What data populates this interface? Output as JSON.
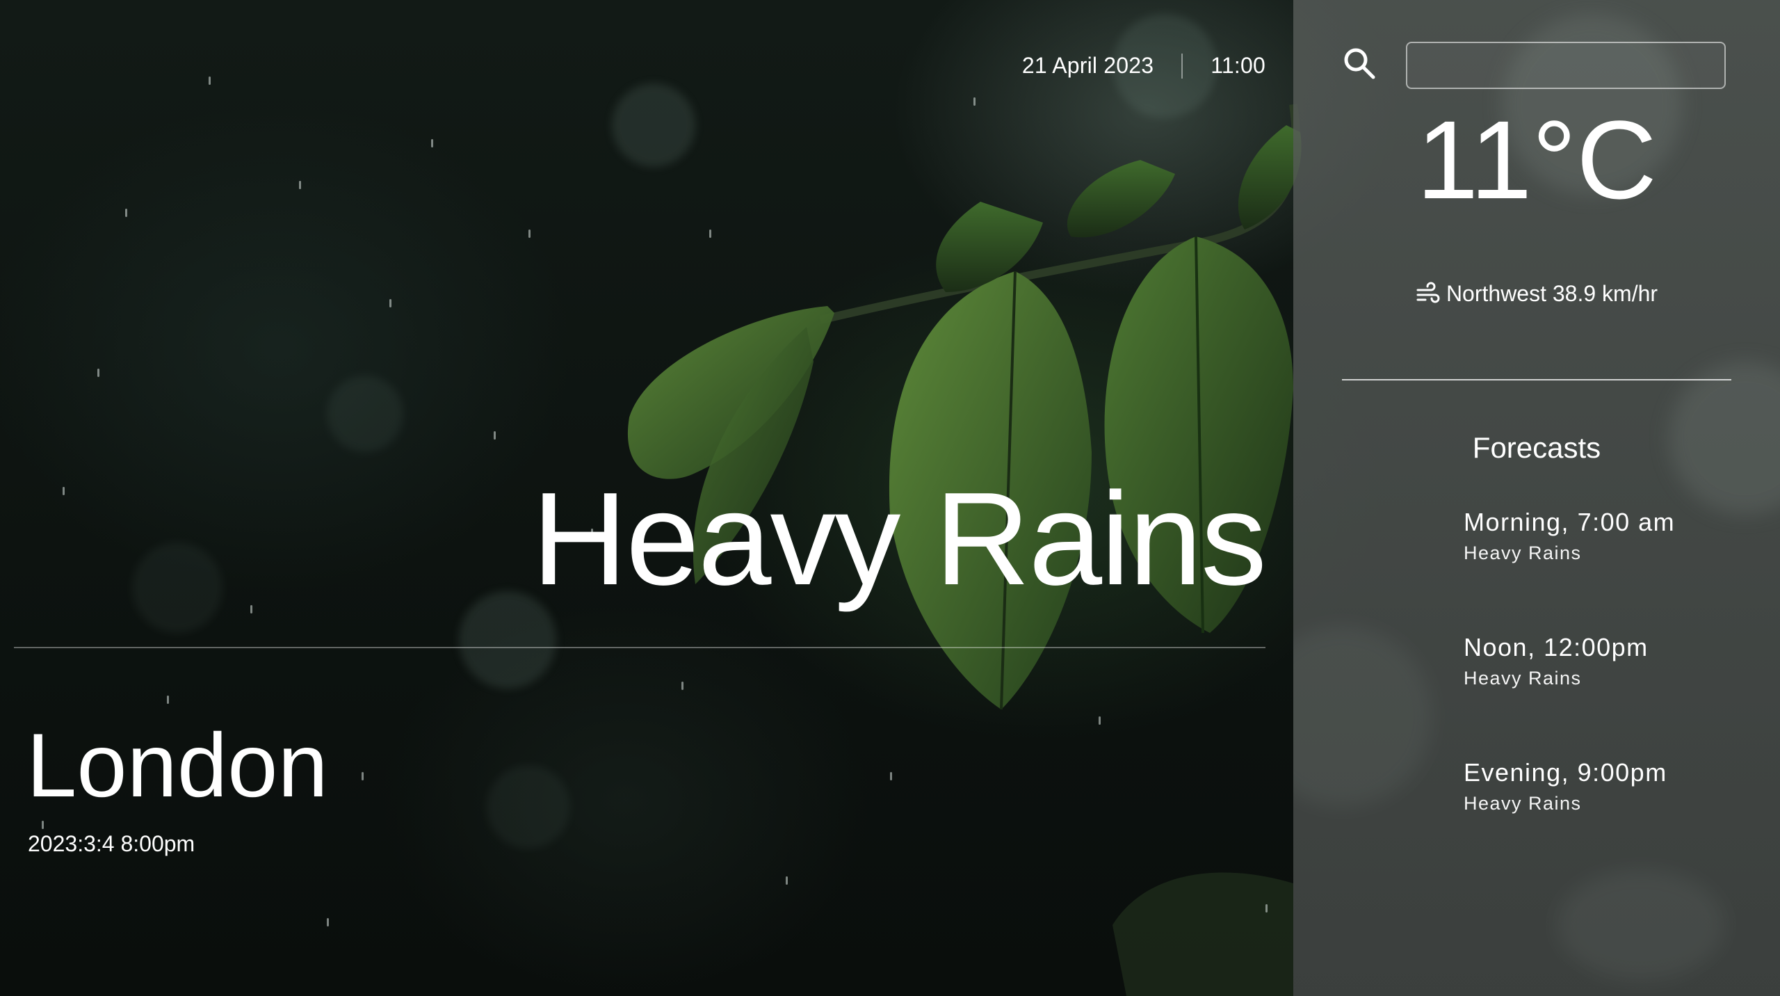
{
  "header": {
    "date": "21 April 2023",
    "time": "11:00"
  },
  "main": {
    "condition": "Heavy Rains",
    "city": "London",
    "city_datetime": "2023:3:4 8:00pm"
  },
  "panel": {
    "search": {
      "value": "",
      "placeholder": "",
      "icon": "search-icon"
    },
    "temperature": "11°C",
    "wind": {
      "icon": "wind-icon",
      "text": "Northwest 38.9 km/hr"
    },
    "forecasts_title": "Forecasts",
    "forecasts": [
      {
        "when": "Morning, 7:00 am",
        "condition": "Heavy Rains"
      },
      {
        "when": "Noon, 12:00pm",
        "condition": "Heavy Rains"
      },
      {
        "when": "Evening, 9:00pm",
        "condition": "Heavy Rains"
      }
    ]
  }
}
